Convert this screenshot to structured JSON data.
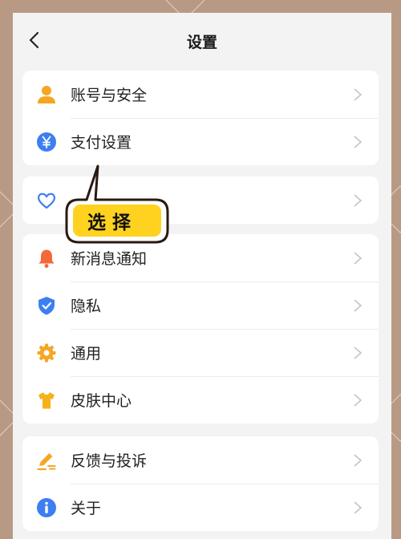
{
  "header": {
    "title": "设置",
    "back_icon": "chevron-left-icon"
  },
  "groups": [
    {
      "items": [
        {
          "label": "账号与安全",
          "icon": "user-icon",
          "color": "#f5a623"
        },
        {
          "label": "支付设置",
          "icon": "yen-icon",
          "color": "#3d7ff0"
        }
      ]
    },
    {
      "items": [
        {
          "label": "",
          "icon": "heart-icon",
          "color": "#3d7ff0"
        }
      ]
    },
    {
      "items": [
        {
          "label": "新消息通知",
          "icon": "bell-icon",
          "color": "#f5683a"
        },
        {
          "label": "隐私",
          "icon": "shield-icon",
          "color": "#3d7ff0"
        },
        {
          "label": "通用",
          "icon": "gear-icon",
          "color": "#f5a623"
        },
        {
          "label": "皮肤中心",
          "icon": "tshirt-icon",
          "color": "#f5b21b"
        }
      ]
    },
    {
      "items": [
        {
          "label": "反馈与投诉",
          "icon": "pencil-icon",
          "color": "#f5a623"
        },
        {
          "label": "关于",
          "icon": "info-icon",
          "color": "#3d7ff0"
        }
      ]
    }
  ],
  "callout": {
    "text": "选择",
    "fill": "#ffd21f",
    "outline": "#2a1a10"
  },
  "colors": {
    "background": "#b89a84",
    "panel": "#f3f3f4",
    "card": "#ffffff",
    "chevron": "#c4c4c4"
  }
}
